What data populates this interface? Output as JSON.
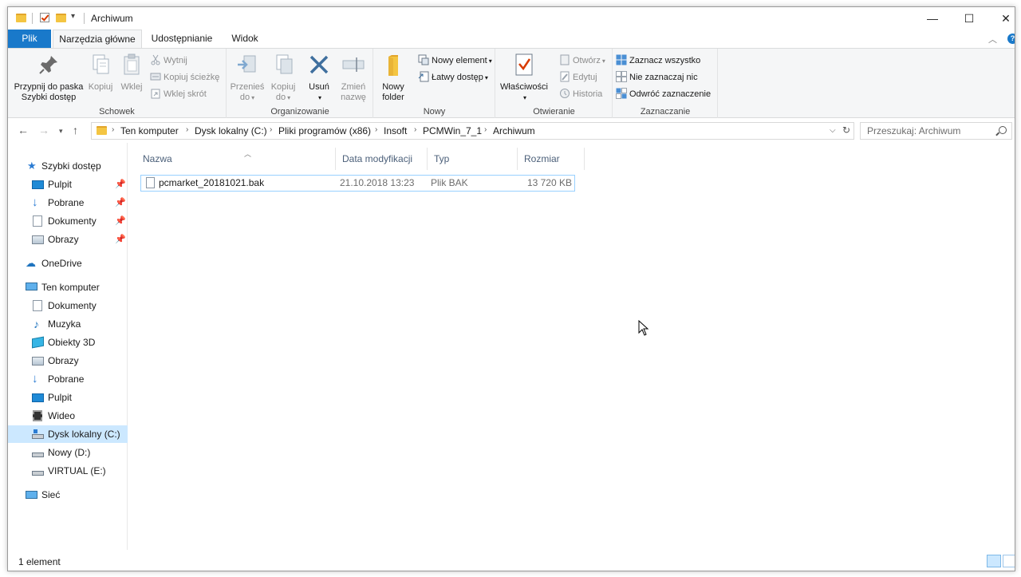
{
  "window": {
    "title": "Archiwum",
    "controls": {
      "minimize": "—",
      "maximize": "☐",
      "close": "✕"
    }
  },
  "ribbon_tabs": [
    {
      "label": "Plik"
    },
    {
      "label": "Narzędzia główne"
    },
    {
      "label": "Udostępnianie"
    },
    {
      "label": "Widok"
    }
  ],
  "ribbon": {
    "groups": {
      "schowek": "Schowek",
      "organizowanie": "Organizowanie",
      "nowy": "Nowy",
      "otwieranie": "Otwieranie",
      "zaznaczanie": "Zaznaczanie"
    },
    "pin_quick_access": {
      "line1": "Przypnij do paska",
      "line2": "Szybki dostęp"
    },
    "copy": "Kopiuj",
    "paste": "Wklej",
    "cut": "Wytnij",
    "copy_path": "Kopiuj ścieżkę",
    "paste_shortcut": "Wklej skrót",
    "move_to": {
      "line1": "Przenieś",
      "line2": "do"
    },
    "copy_to": {
      "line1": "Kopiuj",
      "line2": "do"
    },
    "delete": "Usuń",
    "rename": {
      "line1": "Zmień",
      "line2": "nazwę"
    },
    "new_folder": {
      "line1": "Nowy",
      "line2": "folder"
    },
    "new_item": "Nowy element",
    "easy_access": "Łatwy dostęp",
    "properties": "Właściwości",
    "open": "Otwórz",
    "edit": "Edytuj",
    "history": "Historia",
    "select_all": "Zaznacz wszystko",
    "select_none": "Nie zaznaczaj nic",
    "invert_selection": "Odwróć zaznaczenie"
  },
  "breadcrumbs": [
    "Ten komputer",
    "Dysk lokalny (C:)",
    "Pliki programów (x86)",
    "Insoft",
    "PCMWin_7_1",
    "Archiwum"
  ],
  "search": {
    "placeholder": "Przeszukaj: Archiwum"
  },
  "nav": {
    "quick_access": "Szybki dostęp",
    "quick_items": [
      "Pulpit",
      "Pobrane",
      "Dokumenty",
      "Obrazy"
    ],
    "onedrive": "OneDrive",
    "this_pc": "Ten komputer",
    "pc_items": [
      "Dokumenty",
      "Muzyka",
      "Obiekty 3D",
      "Obrazy",
      "Pobrane",
      "Pulpit",
      "Wideo",
      "Dysk lokalny (C:)",
      "Nowy (D:)",
      "VIRTUAL (E:)"
    ],
    "network": "Sieć"
  },
  "columns": {
    "name": "Nazwa",
    "modified": "Data modyfikacji",
    "type": "Typ",
    "size": "Rozmiar"
  },
  "files": [
    {
      "name": "pcmarket_20181021.bak",
      "modified": "21.10.2018 13:23",
      "type": "Plik BAK",
      "size": "13 720 KB"
    }
  ],
  "status": {
    "count": "1 element"
  }
}
